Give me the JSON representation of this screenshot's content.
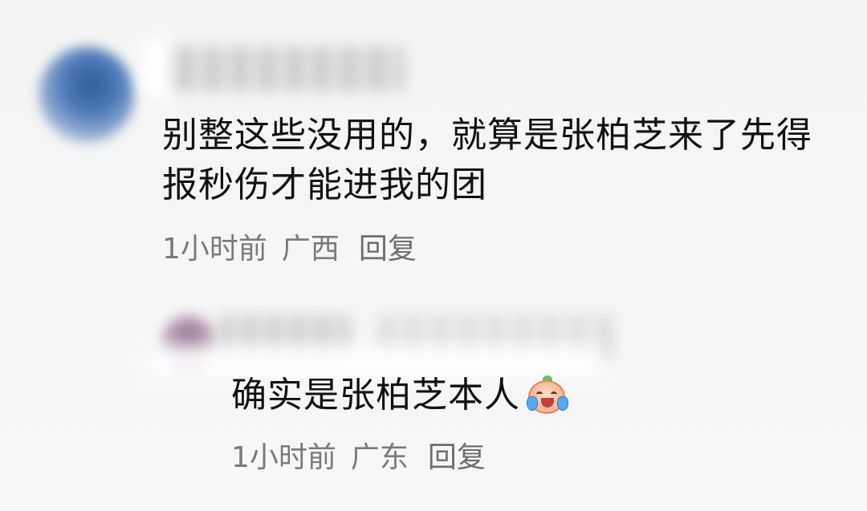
{
  "comments": [
    {
      "text": "别整这些没用的，就算是张柏芝来了先得报秒伤才能进我的团",
      "time": "1小时前",
      "location": "广西",
      "reply_label": "回复"
    },
    {
      "text": "确实是张柏芝本人",
      "emoji": "crying-laughing-peach-emoji",
      "time": "1小时前",
      "location": "广东",
      "reply_label": "回复"
    }
  ]
}
